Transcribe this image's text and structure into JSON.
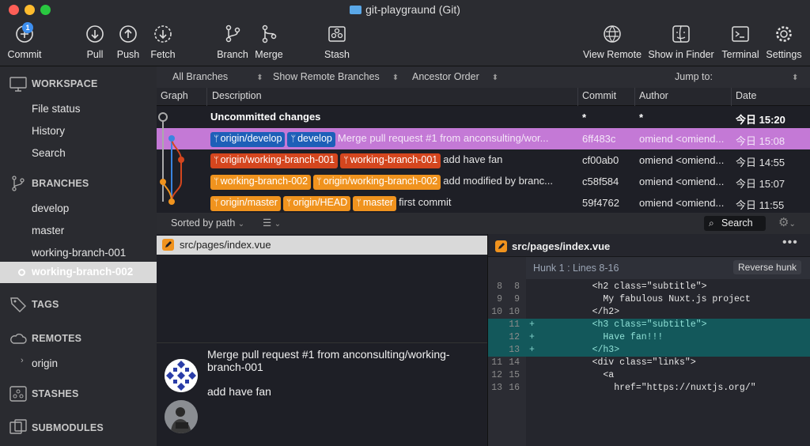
{
  "window": {
    "title": "git-playgraund (Git)",
    "traffic_light_colors": [
      "#fe5f57",
      "#febc2e",
      "#29c840"
    ]
  },
  "toolbar": {
    "commit": {
      "label": "Commit",
      "badge": "1"
    },
    "pull": "Pull",
    "push": "Push",
    "fetch": "Fetch",
    "branch": "Branch",
    "merge": "Merge",
    "stash": "Stash",
    "view_remote": "View Remote",
    "show_in_finder": "Show in Finder",
    "terminal": "Terminal",
    "settings": "Settings"
  },
  "sidebar": {
    "workspace": {
      "title": "WORKSPACE",
      "items": [
        "File status",
        "History",
        "Search"
      ]
    },
    "branches": {
      "title": "BRANCHES",
      "items": [
        "develop",
        "master",
        "working-branch-001",
        "working-branch-002"
      ],
      "selected": "working-branch-002"
    },
    "tags": {
      "title": "TAGS"
    },
    "remotes": {
      "title": "REMOTES",
      "items": [
        "origin"
      ]
    },
    "stashes": {
      "title": "STASHES"
    },
    "submodules": {
      "title": "SUBMODULES"
    }
  },
  "filters": {
    "branches": "All Branches",
    "remote": "Show Remote Branches",
    "order": "Ancestor Order",
    "jump": "Jump to:"
  },
  "columns": {
    "graph": "Graph",
    "description": "Description",
    "commit": "Commit",
    "author": "Author",
    "date": "Date"
  },
  "commits": [
    {
      "tags": [],
      "description": "Uncommitted changes",
      "commit": "*",
      "author": "*",
      "date": "今日 15:20",
      "bold": true
    },
    {
      "tags": [
        {
          "label": "origin/develop",
          "color": "#1d5fb8"
        },
        {
          "label": "develop",
          "color": "#1d5fb8"
        }
      ],
      "description": "Merge pull request #1 from anconsulting/wor...",
      "commit": "6ff483c",
      "author": "omiend <omiend...",
      "date": "今日 15:08",
      "highlight": true
    },
    {
      "tags": [
        {
          "label": "origin/working-branch-001",
          "color": "#d4461e"
        },
        {
          "label": "working-branch-001",
          "color": "#d4461e"
        }
      ],
      "description": "add have fan",
      "commit": "cf00ab0",
      "author": "omiend <omiend...",
      "date": "今日 14:55"
    },
    {
      "tags": [
        {
          "label": "working-branch-002",
          "color": "#f0931e"
        },
        {
          "label": "origin/working-branch-002",
          "color": "#f0931e"
        }
      ],
      "description": "add modified by branc...",
      "commit": "c58f584",
      "author": "omiend <omiend...",
      "date": "今日 15:07"
    },
    {
      "tags": [
        {
          "label": "origin/master",
          "color": "#f0931e"
        },
        {
          "label": "origin/HEAD",
          "color": "#f0931e"
        },
        {
          "label": "master",
          "color": "#f0931e"
        }
      ],
      "description": "first commit",
      "commit": "59f4762",
      "author": "omiend <omiend...",
      "date": "今日 11:55"
    }
  ],
  "lower_toolbar": {
    "sort": "Sorted by path",
    "search": "Search"
  },
  "files": [
    {
      "path": "src/pages/index.vue"
    }
  ],
  "commit_details": [
    {
      "message": "Merge pull request #1 from anconsulting/working-branch-001"
    },
    {
      "message": "add have fan"
    }
  ],
  "diff": {
    "file": "src/pages/index.vue",
    "hunk": "Hunk 1 : Lines 8-16",
    "reverse": "Reverse hunk",
    "lines": [
      {
        "old": "8",
        "new": "8",
        "sign": "",
        "text": "    <h2 class=\"subtitle\">",
        "added": false
      },
      {
        "old": "9",
        "new": "9",
        "sign": "",
        "text": "      My fabulous Nuxt.js project",
        "added": false
      },
      {
        "old": "10",
        "new": "10",
        "sign": "",
        "text": "    </h2>",
        "added": false
      },
      {
        "old": "",
        "new": "11",
        "sign": "+",
        "text": "    <h3 class=\"subtitle\">",
        "added": true
      },
      {
        "old": "",
        "new": "12",
        "sign": "+",
        "text": "      Have fan!!!",
        "added": true
      },
      {
        "old": "",
        "new": "13",
        "sign": "+",
        "text": "    </h3>",
        "added": true
      },
      {
        "old": "11",
        "new": "14",
        "sign": "",
        "text": "    <div class=\"links\">",
        "added": false
      },
      {
        "old": "12",
        "new": "15",
        "sign": "",
        "text": "      <a",
        "added": false
      },
      {
        "old": "13",
        "new": "16",
        "sign": "",
        "text": "        href=\"https://nuxtjs.org/\"",
        "added": false
      }
    ]
  },
  "colors": {
    "selected_row": "#c479d6",
    "added_line": "#13585b",
    "accent": "#3d8ff0"
  }
}
